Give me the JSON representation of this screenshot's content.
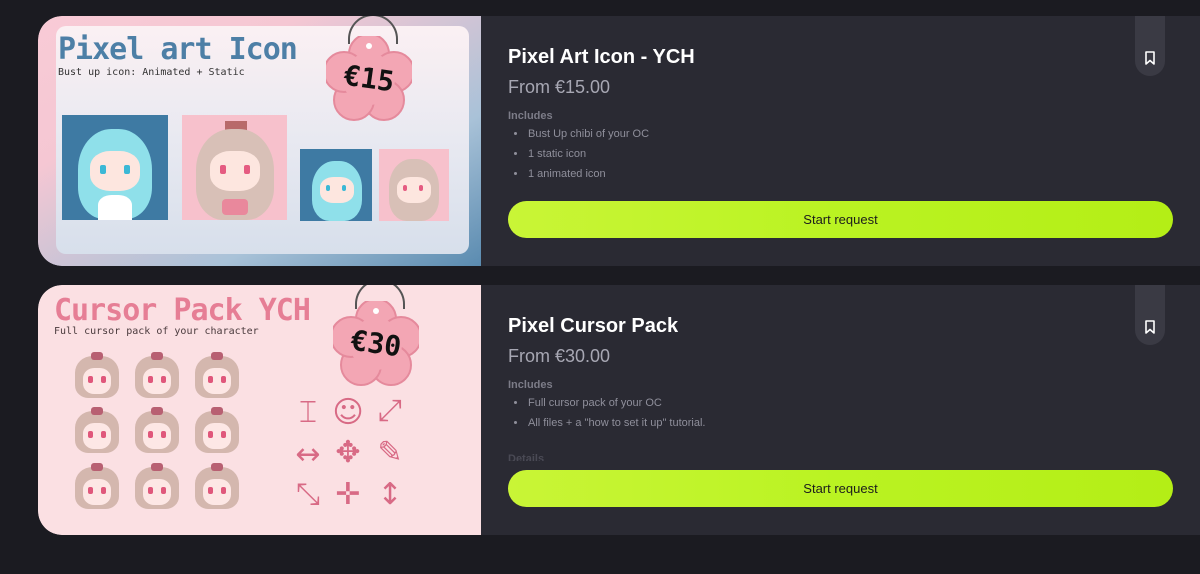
{
  "listings": [
    {
      "thumbnail": {
        "title": "Pixel art Icon",
        "subtitle": "Bust up icon: Animated + Static",
        "price_tag": "€15"
      },
      "title": "Pixel Art Icon - YCH",
      "price": "From €15.00",
      "includes_label": "Includes",
      "includes": [
        "Bust Up chibi of your OC",
        "1 static icon",
        "1 animated icon"
      ],
      "button_label": "Start request",
      "bookmark_icon": "bookmark-icon"
    },
    {
      "thumbnail": {
        "title": "Cursor Pack YCH",
        "subtitle": "Full cursor pack of your character",
        "price_tag": "€30"
      },
      "title": "Pixel Cursor Pack",
      "price": "From €30.00",
      "includes_label": "Includes",
      "includes": [
        "Full cursor pack of your OC",
        "All files + a \"how to set it up\" tutorial."
      ],
      "details_label": "Details",
      "button_label": "Start request",
      "bookmark_icon": "bookmark-icon"
    }
  ],
  "colors": {
    "background": "#1b1b21",
    "card": "#2a2a33",
    "accent_button": "#baf322",
    "title_text": "#ffffff",
    "price_text": "#a7a7b3"
  }
}
